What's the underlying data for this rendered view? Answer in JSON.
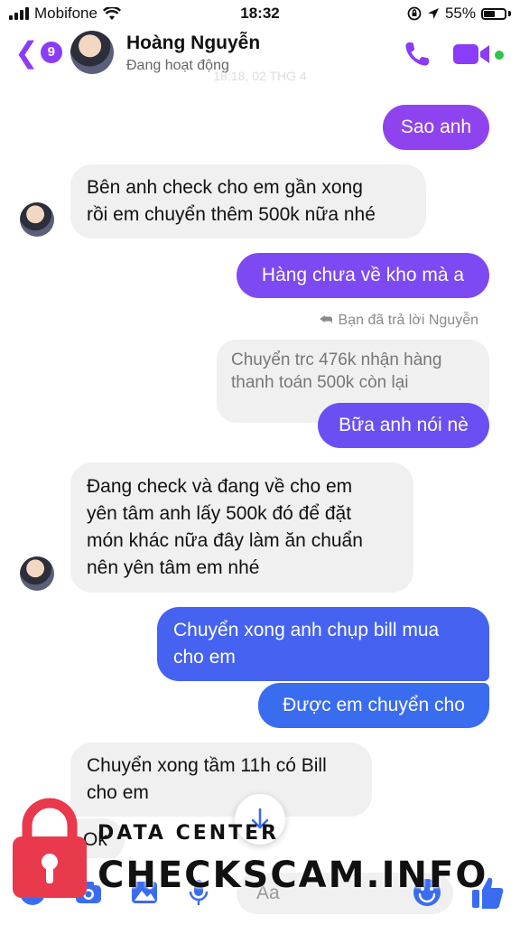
{
  "status_bar": {
    "carrier": "Mobifone",
    "time": "18:32",
    "battery": "55%"
  },
  "header": {
    "back_count": "9",
    "contact_name": "Hoàng Nguyễn",
    "contact_status": "Đang hoạt động",
    "faded_timestamp": "18:18, 02 THG 4"
  },
  "messages": [
    {
      "direction": "out",
      "text": "Sao anh"
    },
    {
      "direction": "in",
      "lines": [
        "Bên anh check cho em gần xong",
        "rồi em chuyển thêm 500k nữa nhé"
      ]
    },
    {
      "direction": "out",
      "text": "Hàng chưa về kho mà a"
    },
    {
      "direction": "out",
      "reply_label": "Bạn đã trả lời Nguyễn",
      "quoted_lines": [
        "Chuyển trc 476k nhận hàng",
        "thanh toán 500k còn lại"
      ],
      "text": "Bữa anh nói nè"
    },
    {
      "direction": "in",
      "lines": [
        "Đang check và đang về cho em",
        "yên tâm anh lấy 500k đó để đặt",
        "món khác nữa đây làm ăn chuẩn",
        "nên yên tâm em nhé"
      ]
    },
    {
      "direction": "out",
      "lines": [
        "Chuyển xong anh chụp bill mua",
        "cho em"
      ]
    },
    {
      "direction": "out",
      "text": "Được em chuyển cho"
    },
    {
      "direction": "in",
      "lines": [
        "Chuyển xong tầm 11h có Bill",
        "cho em"
      ]
    },
    {
      "direction": "in",
      "text": "Ok"
    }
  ],
  "composer": {
    "placeholder": "Aa"
  },
  "watermark": {
    "line1": "DATA CENTER",
    "line2": "CHECKSCAM.INFO"
  },
  "colors": {
    "accent_purple": "#8b3cf7",
    "bubble_purple": "#8f43ee",
    "bubble_indigo": "#6b4ff2",
    "bubble_blue": "#3a6cf0",
    "incoming_bg": "#f0f0f0",
    "watermark_red": "#e8394d"
  },
  "icons": [
    "back-chevron-icon",
    "phone-icon",
    "video-camera-icon",
    "reply-arrow-icon",
    "scroll-down-arrow-icon",
    "menu-icon",
    "camera-icon",
    "gallery-icon",
    "microphone-icon",
    "emoji-icon",
    "thumbs-up-icon",
    "lock-icon"
  ]
}
